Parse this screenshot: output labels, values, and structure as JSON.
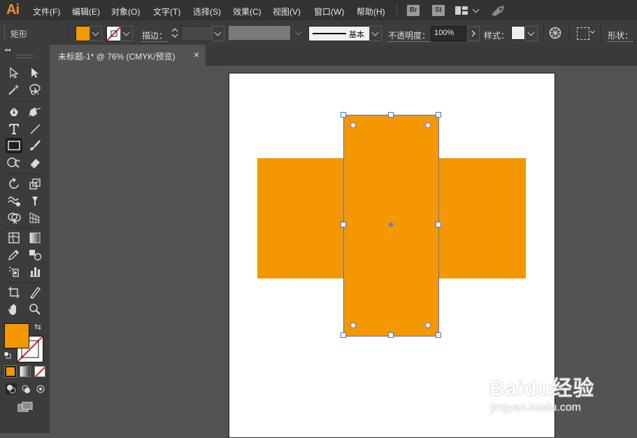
{
  "app": {
    "logo": "Ai"
  },
  "menu": [
    "文件(F)",
    "编辑(E)",
    "对象(O)",
    "文字(T)",
    "选择(S)",
    "效果(C)",
    "视图(V)",
    "窗口(W)",
    "帮助(H)"
  ],
  "menubar_icons": {
    "bridge": "Br",
    "stock": "St"
  },
  "control_bar": {
    "tool_name": "矩形",
    "stroke_label": "描边：",
    "stroke_style": "基本",
    "opacity_label": "不透明度：",
    "opacity_value": "100%",
    "style_label": "样式：",
    "shape_label": "形状："
  },
  "document": {
    "tab_title": "未标题-1* @ 76% (CMYK/预览)",
    "close": "×"
  },
  "colors": {
    "fill": "#f39800",
    "accent": "#e8912f",
    "selection": "#4d6fd6"
  },
  "watermark": {
    "brand": "Baidu经验",
    "url": "jingyan.baidu.com"
  }
}
